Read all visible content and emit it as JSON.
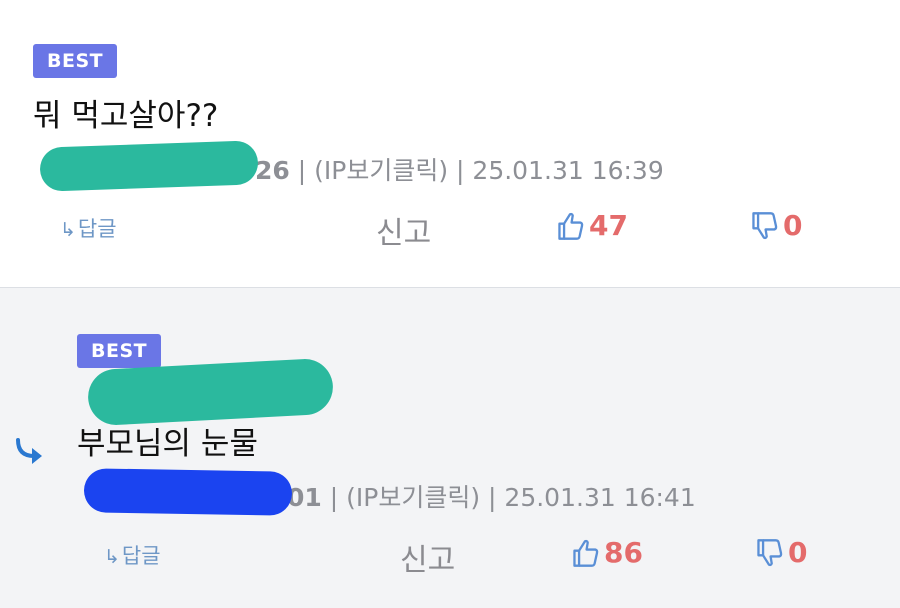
{
  "comments": [
    {
      "badge": "BEST",
      "body": "뭐 먹고살아??",
      "author_tail": "26",
      "ip_link": "(IP보기클릭)",
      "timestamp": "25.01.31 16:39",
      "reply_label": "답글",
      "report_label": "신고",
      "likes": "47",
      "dislikes": "0",
      "redaction_color": "#2bb99e"
    },
    {
      "badge": "BEST",
      "body": "부모님의 눈물",
      "author_tail": "01",
      "ip_link": "(IP보기클릭)",
      "timestamp": "25.01.31 16:41",
      "reply_label": "답글",
      "report_label": "신고",
      "likes": "86",
      "dislikes": "0",
      "redaction_color": "#1b44f0"
    }
  ],
  "icons": {
    "reply": "reply-arrow-icon",
    "like": "thumbs-up-icon",
    "dislike": "thumbs-down-icon",
    "nested": "nested-reply-arrow-icon"
  },
  "colors": {
    "badge": "#6a76e6",
    "vote_count": "#e46b6b",
    "icon_blue": "#5a8fd6",
    "reply_link": "#6e97c6",
    "redaction_green": "#2bb99e"
  }
}
